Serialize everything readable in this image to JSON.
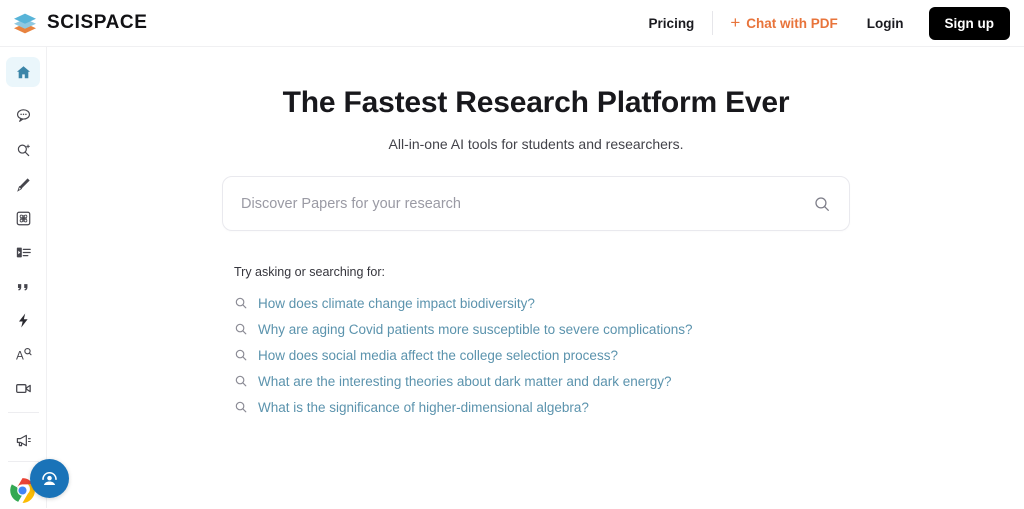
{
  "brand": {
    "name": "SCISPACE",
    "logo_icon": "scispace-stacked-diamond-logo",
    "logo_colors": {
      "top": "#58b4d8",
      "bottom": "#e8833f"
    }
  },
  "header": {
    "pricing_label": "Pricing",
    "chat_with_pdf_label": "Chat with PDF",
    "chat_with_pdf_icon": "plus-icon",
    "chat_with_pdf_color": "#e8743b",
    "login_label": "Login",
    "signup_label": "Sign up",
    "signup_bg": "#000000",
    "signup_color": "#ffffff"
  },
  "sidebar": {
    "active_color": "#3b85a8",
    "active_bg": "#eaf6fb",
    "icon_color": "#46464d",
    "items": [
      {
        "name": "home",
        "icon": "home-icon",
        "active": true
      },
      {
        "name": "chat",
        "icon": "chat-bubble-icon",
        "active": false
      },
      {
        "name": "literature-review",
        "icon": "search-document-icon",
        "active": false
      },
      {
        "name": "paraphraser",
        "icon": "pencil-icon",
        "active": false
      },
      {
        "name": "extract-data",
        "icon": "atom-icon",
        "active": false
      },
      {
        "name": "summarize",
        "icon": "list-lines-icon",
        "active": false
      },
      {
        "name": "citation-generator",
        "icon": "quote-marks-icon",
        "active": false
      },
      {
        "name": "ai-writer",
        "icon": "lightning-bolt-icon",
        "active": false
      },
      {
        "name": "ai-detector",
        "icon": "a-magnifier-icon",
        "active": false
      },
      {
        "name": "video-tutorials",
        "icon": "video-camera-icon",
        "active": false
      },
      {
        "name": "announcements",
        "icon": "megaphone-icon",
        "active": false
      }
    ],
    "chrome_icon": "chrome-browser-icon",
    "support_icon": "support-agent-icon",
    "support_bg": "#1a73b8"
  },
  "main": {
    "title": "The Fastest Research Platform Ever",
    "subtitle": "All-in-one AI tools for students and researchers.",
    "search": {
      "value": "",
      "placeholder": "Discover Papers for your research",
      "button_icon": "search-icon"
    },
    "suggestions": {
      "heading": "Try asking or searching for:",
      "link_color": "#5b93ad",
      "items": [
        "How does climate change impact biodiversity?",
        "Why are aging Covid patients more susceptible to severe complications?",
        "How does social media affect the college selection process?",
        "What are the interesting theories about dark matter and dark energy?",
        "What is the significance of higher-dimensional algebra?"
      ]
    }
  }
}
